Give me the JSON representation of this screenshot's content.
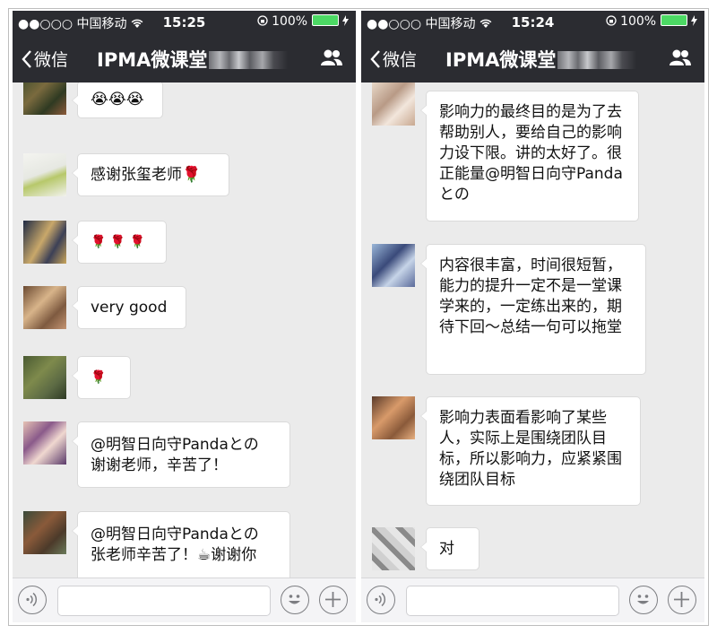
{
  "screens": [
    {
      "status": {
        "signal": "●●○○○ 中国移动",
        "wifi": "wifi",
        "time": "15:25",
        "battery_text": "100%"
      },
      "nav": {
        "back_label": "微信",
        "title": "IPMA微课堂"
      },
      "messages": [
        {
          "text": "😭😭😭"
        },
        {
          "text": "感谢张玺老师🌹"
        },
        {
          "text": "🌹 🌹 🌹"
        },
        {
          "text": "very  good"
        },
        {
          "text": "🌹"
        },
        {
          "text": "@明智日向守Pandaとの 谢谢老师，辛苦了！"
        },
        {
          "text": "@明智日向守Pandaとの 张老师辛苦了！☕谢谢你"
        }
      ]
    },
    {
      "status": {
        "signal": "●●○○○ 中国移动",
        "wifi": "wifi",
        "time": "15:24",
        "battery_text": "100%"
      },
      "nav": {
        "back_label": "微信",
        "title": "IPMA微课堂"
      },
      "messages": [
        {
          "text": "影响力的最终目的是为了去帮助别人，要给自己的影响力设下限。讲的太好了。很正能量@明智日向守Pandaとの"
        },
        {
          "text": "内容很丰富，时间很短暂，能力的提升一定不是一堂课学来的，一定练出来的，期待下回～总结一句可以拖堂"
        },
        {
          "text": "影响力表面看影响了某些人，实际上是围绕团队目标，所以影响力，应紧紧围绕团队目标"
        },
        {
          "text": "对"
        }
      ]
    }
  ],
  "colors": {
    "navbar": "#2b2c31",
    "chat_bg": "#ebebeb",
    "bubble": "#ffffff",
    "battery": "#4cd964"
  },
  "icons": [
    "back-chevron-icon",
    "group-members-icon",
    "voice-icon",
    "emoji-icon",
    "plus-icon",
    "wifi-icon",
    "lock-rotation-icon",
    "charging-icon"
  ]
}
